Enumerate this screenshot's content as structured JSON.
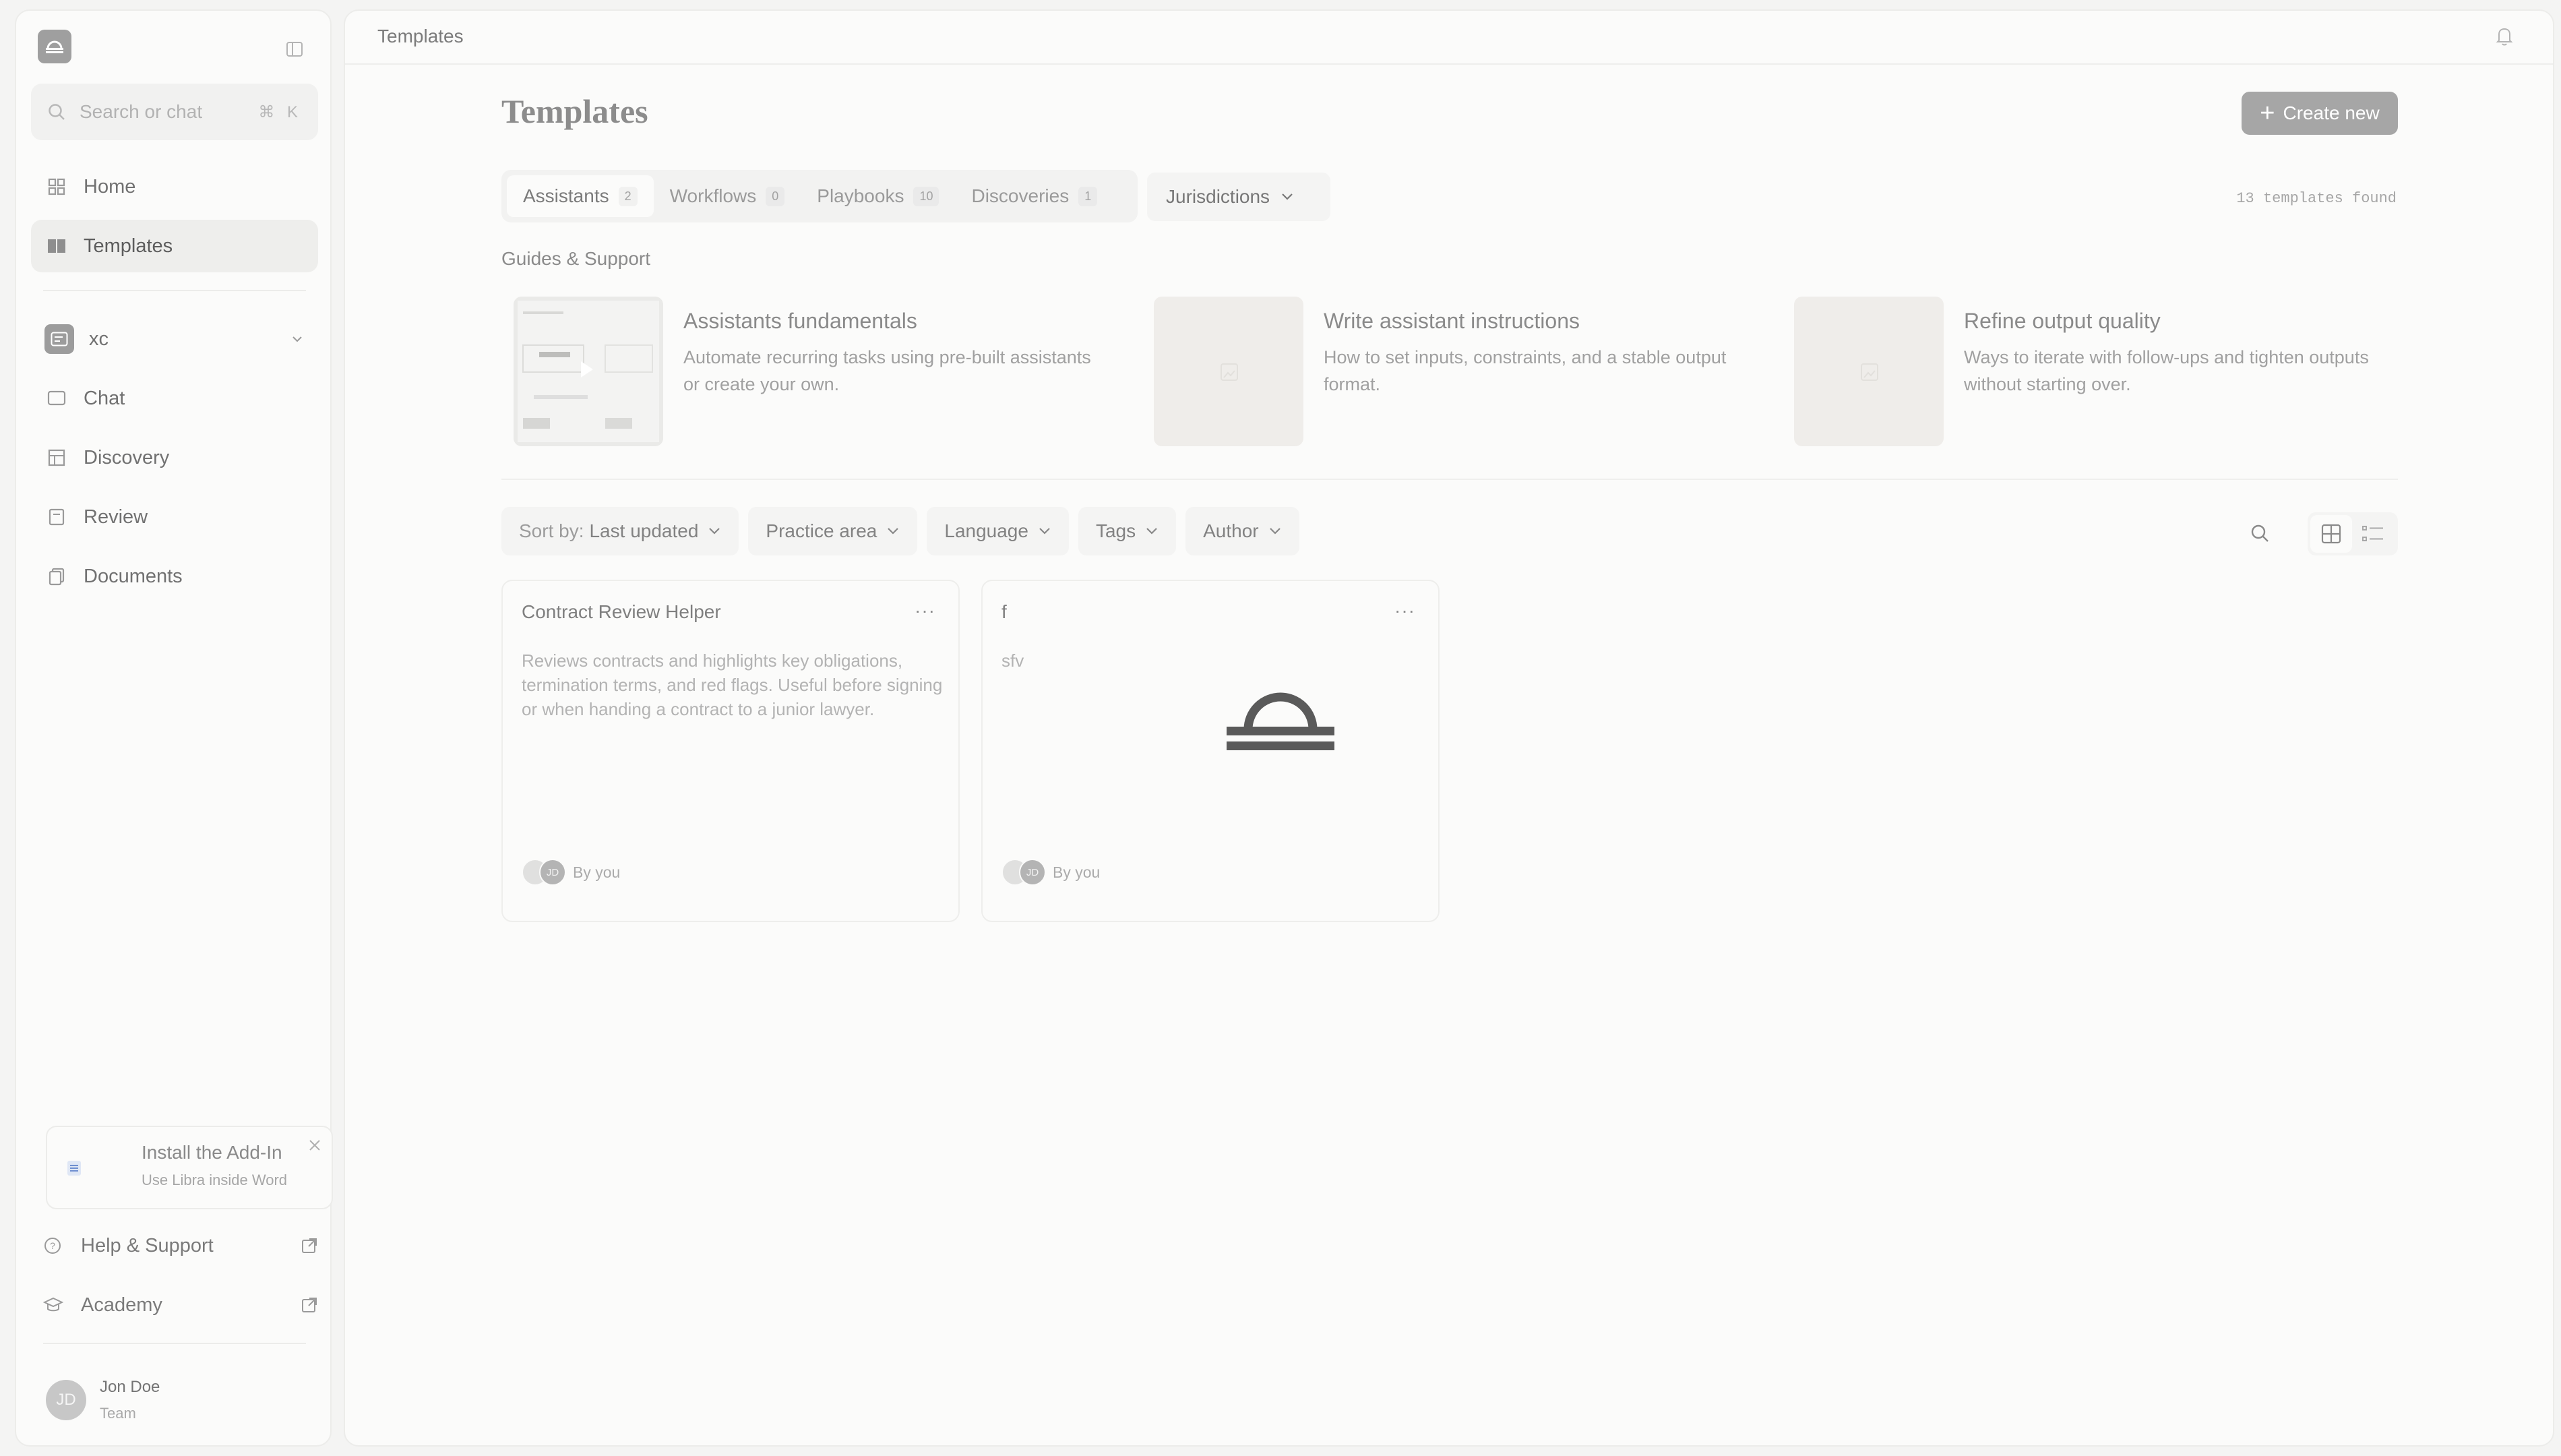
{
  "sidebar": {
    "search": {
      "placeholder": "Search or chat",
      "shortcut": "⌘ K"
    },
    "nav": [
      {
        "label": "Home",
        "icon": "home-icon"
      },
      {
        "label": "Templates",
        "icon": "templates-icon",
        "active": true
      }
    ],
    "workspace": {
      "name": "xc"
    },
    "workspace_nav": [
      {
        "label": "Chat",
        "icon": "chat-icon"
      },
      {
        "label": "Discovery",
        "icon": "discovery-icon"
      },
      {
        "label": "Review",
        "icon": "review-icon"
      },
      {
        "label": "Documents",
        "icon": "documents-icon"
      }
    ],
    "addin": {
      "title": "Install the Add-In",
      "subtitle": "Use Libra inside Word"
    },
    "links": [
      {
        "label": "Help & Support",
        "icon": "help-icon"
      },
      {
        "label": "Academy",
        "icon": "academy-icon"
      }
    ],
    "user": {
      "initials": "JD",
      "name": "Jon Doe",
      "team": "Team"
    }
  },
  "header": {
    "breadcrumb": "Templates"
  },
  "page": {
    "title": "Templates",
    "create_label": "Create new",
    "tabs": [
      {
        "label": "Assistants",
        "count": "2",
        "active": true
      },
      {
        "label": "Workflows",
        "count": "0"
      },
      {
        "label": "Playbooks",
        "count": "10"
      },
      {
        "label": "Discoveries",
        "count": "1"
      }
    ],
    "jurisdictions_label": "Jurisdictions",
    "found_text": "13 templates found",
    "guides_title": "Guides & Support",
    "guides": [
      {
        "title": "Assistants fundamentals",
        "desc": "Automate recurring tasks using pre-built assistants or create your own."
      },
      {
        "title": "Write assistant instructions",
        "desc": "How to set inputs, constraints, and a stable output format."
      },
      {
        "title": "Refine output quality",
        "desc": "Ways to iterate with follow-ups and tighten outputs without starting over."
      }
    ],
    "filters": {
      "sort_prefix": "Sort by:",
      "sort_value": "Last updated",
      "practice": "Practice area",
      "language": "Language",
      "tags": "Tags",
      "author": "Author"
    },
    "cards": [
      {
        "title": "Contract Review Helper",
        "desc": "Reviews contracts and highlights key obligations, termination terms, and red flags. Useful before signing or when handing a contract to a junior lawyer.",
        "initials": "JD",
        "author": "By you"
      },
      {
        "title": "f",
        "desc": "sfv",
        "initials": "JD",
        "author": "By you"
      }
    ]
  },
  "colors": {
    "accent_button": "#a6a6a6",
    "background": "#f4f4f3",
    "panel": "#fbfbfa"
  }
}
